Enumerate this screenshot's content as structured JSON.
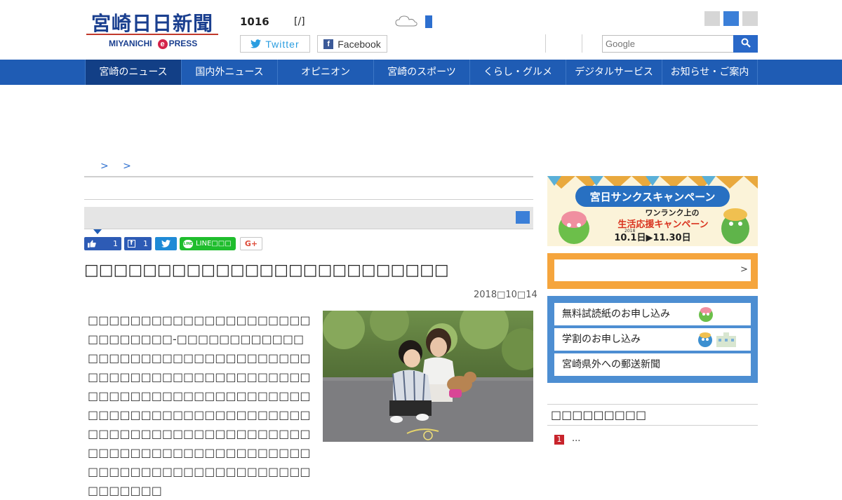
{
  "header": {
    "logo_title": "宮崎日日新聞",
    "logo_sub": "MIYANICHI",
    "logo_e": "e",
    "logo_press": "PRESS",
    "pressure": "1016",
    "pressure_unit": "[/]",
    "twitter_label": "Twitter",
    "facebook_label": "Facebook",
    "search_placeholder": "Google"
  },
  "nav": {
    "items": [
      {
        "label": "宮崎のニュース"
      },
      {
        "label": "国内外ニュース"
      },
      {
        "label": "オピニオン"
      },
      {
        "label": "宮崎のスポーツ"
      },
      {
        "label": "くらし・グルメ"
      },
      {
        "label": "デジタルサービス"
      },
      {
        "label": "お知らせ・ご案内"
      }
    ]
  },
  "breadcrumb": {
    "separators": "> >"
  },
  "share": {
    "like_count": "1",
    "fb_count": "1",
    "line_label": "LINE□□□",
    "gplus_label": "G+"
  },
  "article": {
    "title": "□□□□□□□□□□□□□□□□□□□□□□□□□",
    "date": "2018□10□14",
    "body": "□□□□□□□□□□□□□□□□□□□□□□□□□□□□□-□□□□□□□□□□□□□□□□□□□□□□□□□□□□□□□□□□□□□□□□□□□□□□□□□□□□□□□□□□□□□□□□□□□□□□□□□□□□□□□□□□□□□□□□□□□□□□□□□□□□□□□□□□□□□□□□□□□□□□□□□□□□□□□□□□□□□□□□□□□□□□□□□□□□□□□□□□□□□□□□□□□□□□"
  },
  "sidebar": {
    "campaign_title": "宮日サンクスキャンペーン",
    "campaign_sub1": "ワンランク上の",
    "campaign_sub2": "生活応援キャンペーン",
    "campaign_year": "2018",
    "campaign_dates": "10.1日▶11.30日",
    "orange_chevron": ">",
    "links": [
      {
        "label": "無料試読紙のお申し込み"
      },
      {
        "label": "学割のお申し込み"
      },
      {
        "label": "宮崎県外への郵送新聞"
      }
    ],
    "ranking_title": "□□□□□□□□□",
    "ranking_first_num": "1",
    "ranking_first_text": "..."
  },
  "colors": {
    "nav_bg": "#1f5cb4",
    "nav_active": "#123f86",
    "accent_blue": "#3b7fd8",
    "orange": "#f5a53d",
    "sidebar_blue": "#4d8ed2",
    "line_green": "#1fbd2d"
  }
}
